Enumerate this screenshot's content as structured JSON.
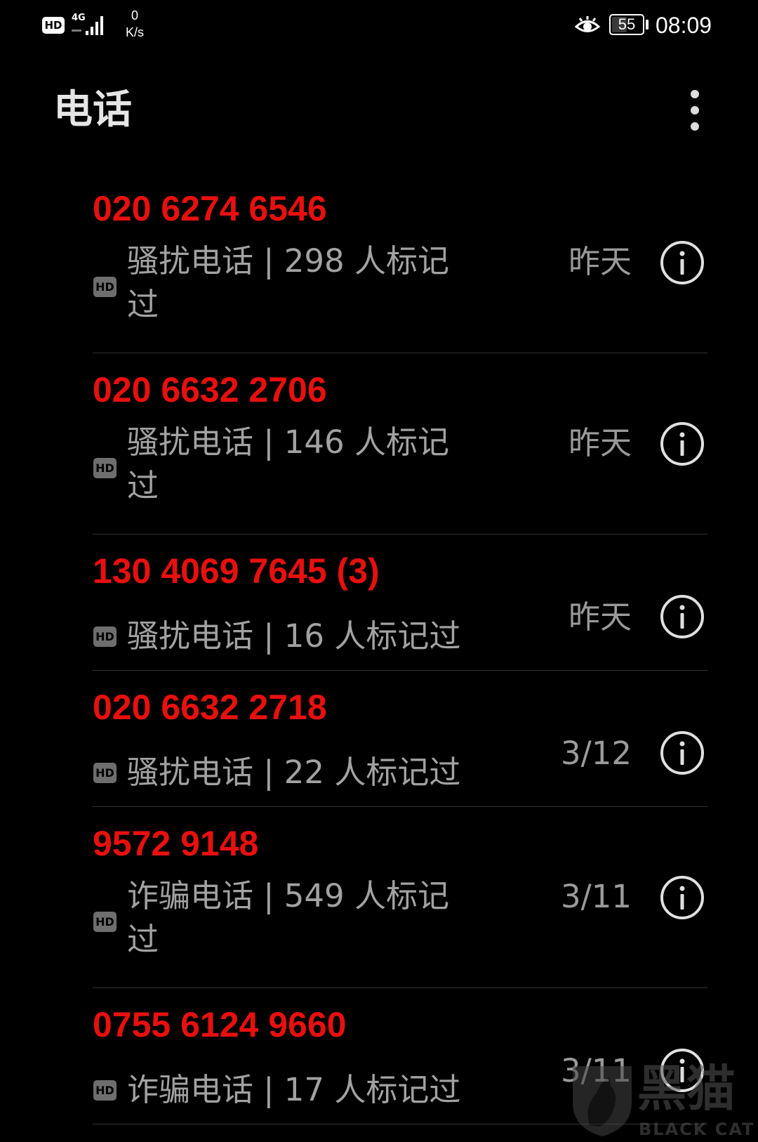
{
  "status_bar": {
    "hd_label": "HD",
    "network_label": "4G",
    "speed_value": "0",
    "speed_unit": "K/s",
    "battery_level": 55,
    "battery_text": "55",
    "time": "08:09",
    "icons": [
      "signal-bars-icon",
      "eye-comfort-icon",
      "battery-icon"
    ]
  },
  "header": {
    "title": "电话",
    "menu_icon": "more-vertical-icon"
  },
  "calls": [
    {
      "number": "020 6274 6546",
      "hd": "HD",
      "description": "骚扰电话 | 298 人标记过",
      "date": "昨天"
    },
    {
      "number": "020 6632 2706",
      "hd": "HD",
      "description": "骚扰电话 | 146 人标记过",
      "date": "昨天"
    },
    {
      "number": "130 4069 7645 (3)",
      "hd": "HD",
      "description": "骚扰电话 | 16 人标记过",
      "date": "昨天"
    },
    {
      "number": "020 6632 2718",
      "hd": "HD",
      "description": "骚扰电话 | 22 人标记过",
      "date": "3/12"
    },
    {
      "number": "9572 9148",
      "hd": "HD",
      "description": "诈骗电话 | 549 人标记过",
      "date": "3/11"
    },
    {
      "number": "0755 6124 9660",
      "hd": "HD",
      "description": "诈骗电话 | 17 人标记过",
      "date": "3/11"
    }
  ],
  "watermark": {
    "text": "黑猫",
    "sub": "BLACK CAT"
  },
  "colors": {
    "background": "#000000",
    "missed_call": "#e8100f",
    "secondary_text": "#a2a2a2"
  }
}
